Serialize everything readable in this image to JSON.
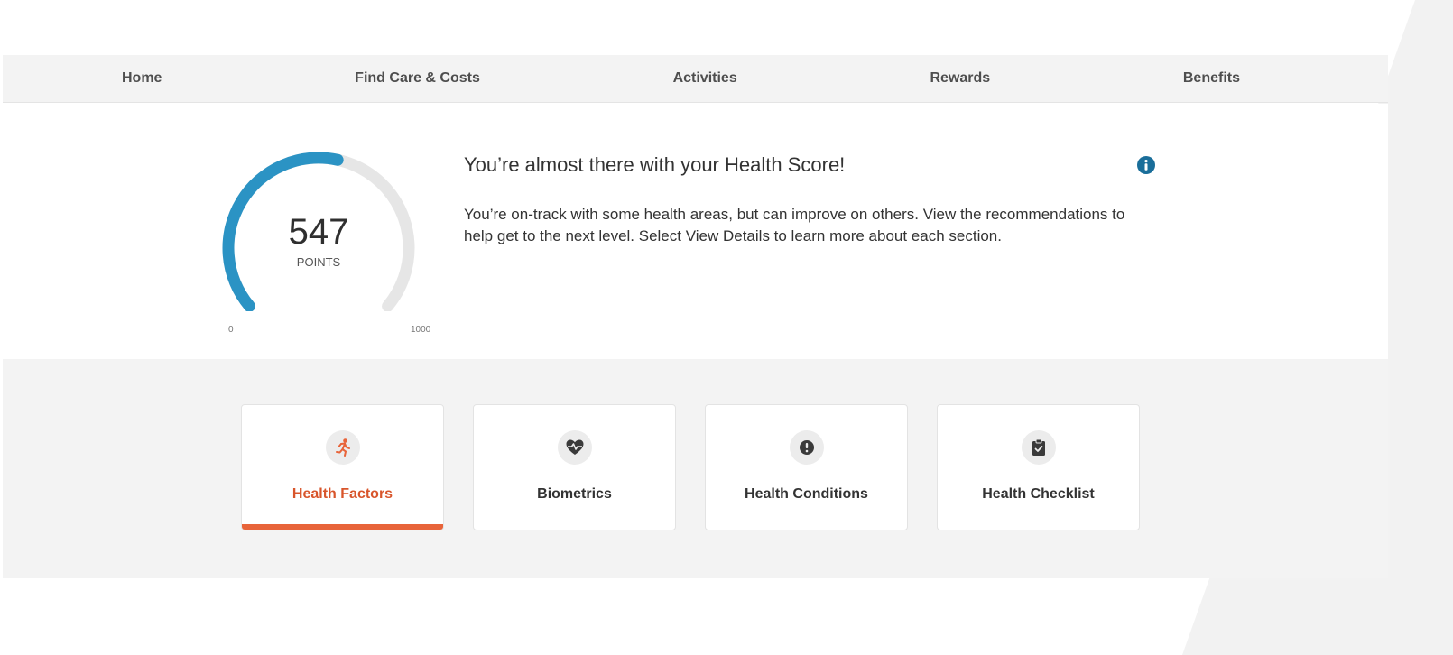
{
  "nav": {
    "items": [
      {
        "label": "Home"
      },
      {
        "label": "Find Care & Costs"
      },
      {
        "label": "Activities"
      },
      {
        "label": "Rewards"
      },
      {
        "label": "Benefits"
      }
    ]
  },
  "health_score": {
    "value": "547",
    "unit": "POINTS",
    "min": "0",
    "max": "1000",
    "value_fraction": 0.547,
    "title": "You’re almost there with your Health Score!",
    "description": "You’re on-track with some health areas, but can improve on others. View the recommendations to help get to the next level. Select View Details to learn more about each section.",
    "info_icon": "info-icon"
  },
  "tiles": [
    {
      "label": "Health Factors",
      "icon": "running-person-icon",
      "active": true
    },
    {
      "label": "Biometrics",
      "icon": "heartbeat-icon",
      "active": false
    },
    {
      "label": "Health Conditions",
      "icon": "alert-circle-icon",
      "active": false
    },
    {
      "label": "Health Checklist",
      "icon": "clipboard-check-icon",
      "active": false
    }
  ],
  "colors": {
    "gauge_fill": "#2b93c4",
    "gauge_track": "#e6e6e6",
    "accent_orange": "#e8643a",
    "active_label": "#d8552b",
    "info_blue": "#1a6e9a",
    "nav_bg": "#f3f3f3"
  }
}
